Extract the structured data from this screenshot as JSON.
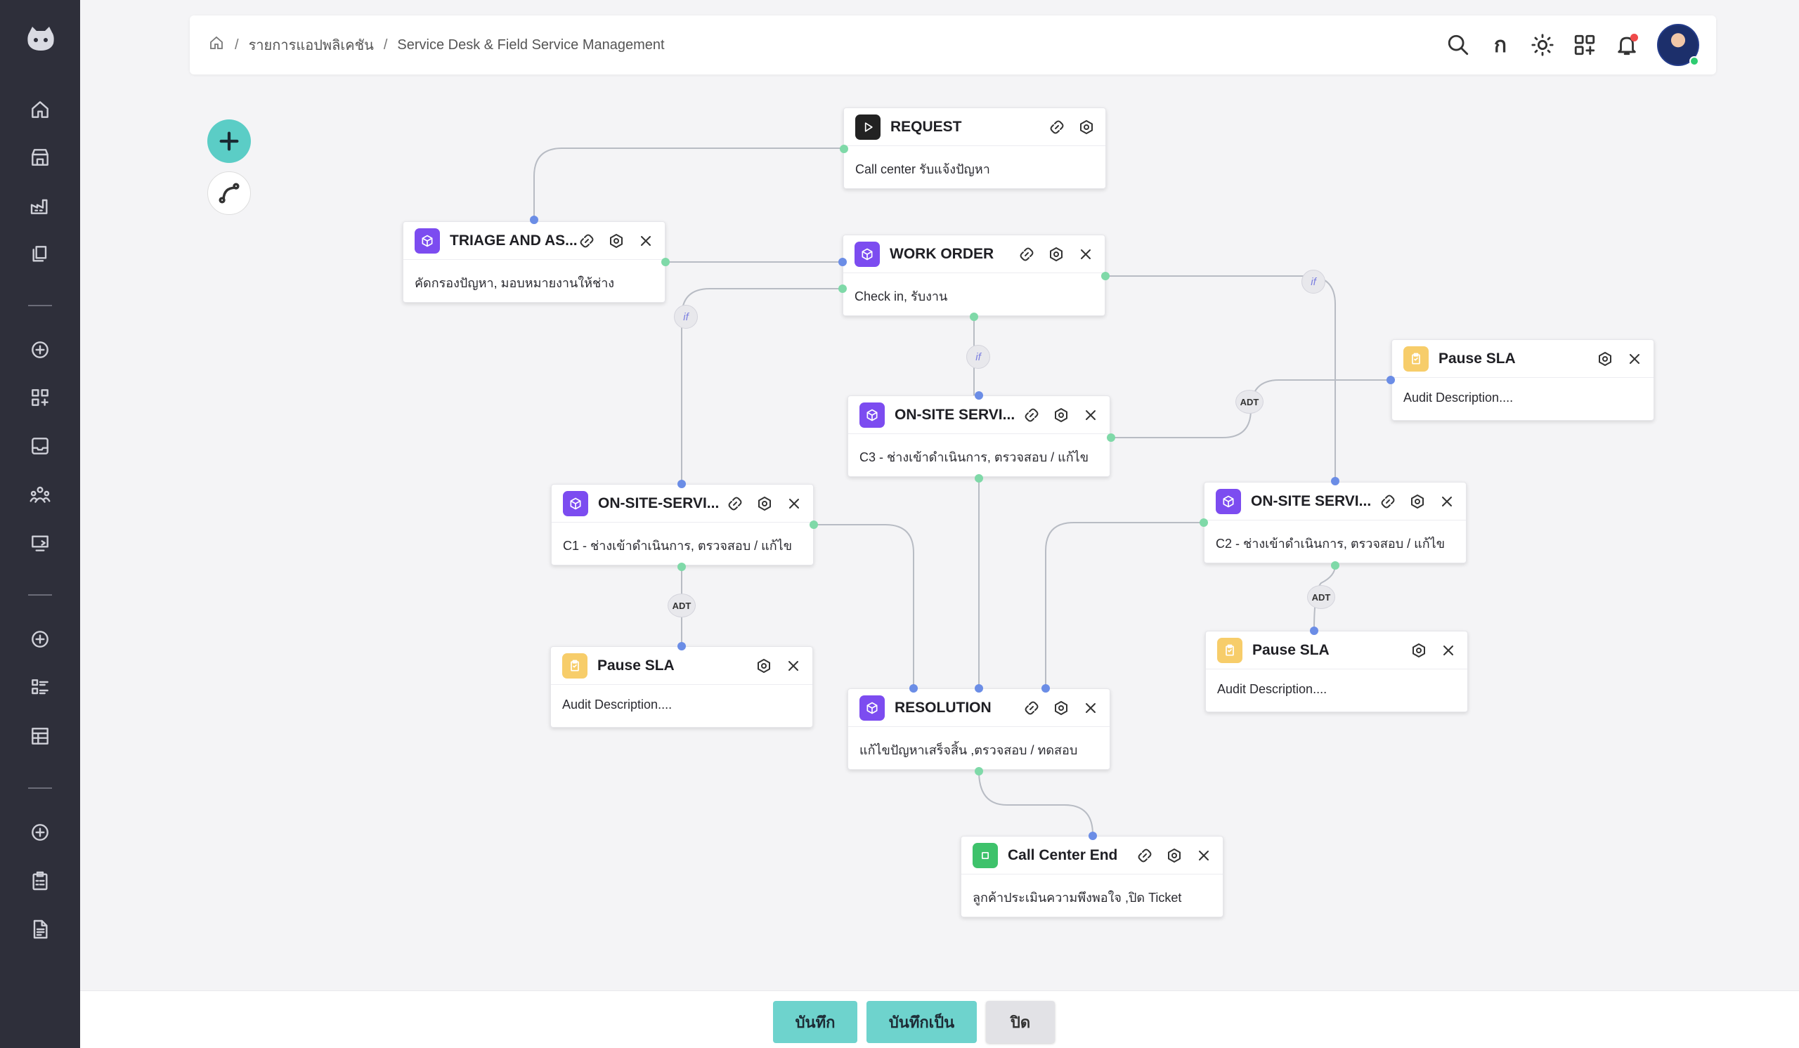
{
  "breadcrumb": {
    "level1": "รายการแอปพลิเคชัน",
    "level2": "Service Desk & Field Service Management",
    "separator": "/"
  },
  "header": {
    "letter_icon": "ก"
  },
  "nodes": {
    "request": {
      "title": "REQUEST",
      "desc": "Call center รับแจ้งปัญหา"
    },
    "triage": {
      "title": "TRIAGE AND AS...",
      "desc": "คัดกรองปัญหา, มอบหมายงานให้ช่าง"
    },
    "work_order": {
      "title": "WORK ORDER",
      "desc": "Check in, รับงาน"
    },
    "onsite_c3": {
      "title": "ON-SITE SERVI...",
      "desc": "C3 - ช่างเข้าดำเนินการ, ตรวจสอบ / แก้ไข"
    },
    "onsite_c1": {
      "title": "ON-SITE-SERVI...",
      "desc": "C1 - ช่างเข้าดำเนินการ, ตรวจสอบ / แก้ไข"
    },
    "onsite_c2": {
      "title": "ON-SITE SERVI...",
      "desc": "C2 - ช่างเข้าดำเนินการ, ตรวจสอบ / แก้ไข"
    },
    "pause_sla_1": {
      "title": "Pause SLA",
      "desc": "Audit Description...."
    },
    "pause_sla_2": {
      "title": "Pause SLA",
      "desc": "Audit Description...."
    },
    "pause_sla_3": {
      "title": "Pause SLA",
      "desc": "Audit Description...."
    },
    "resolution": {
      "title": "RESOLUTION",
      "desc": "แก้ไขปัญหาเสร็จสิ้น ,ตรวจสอบ / ทดสอบ"
    },
    "call_center_end": {
      "title": "Call Center End",
      "desc": "ลูกค้าประเมินความพึงพอใจ ,ปิด Ticket"
    }
  },
  "edge_labels": {
    "if": "if",
    "adt": "ADT"
  },
  "footer": {
    "save": "บันทึก",
    "save_as": "บันทึกเป็น",
    "close": "ปิด"
  },
  "colors": {
    "accent": "#6ed3cd",
    "sidebar": "#2e2f3a",
    "node_purple": "#7c4cf0",
    "node_yellow": "#f7cd6a",
    "node_green": "#3ec26b"
  }
}
